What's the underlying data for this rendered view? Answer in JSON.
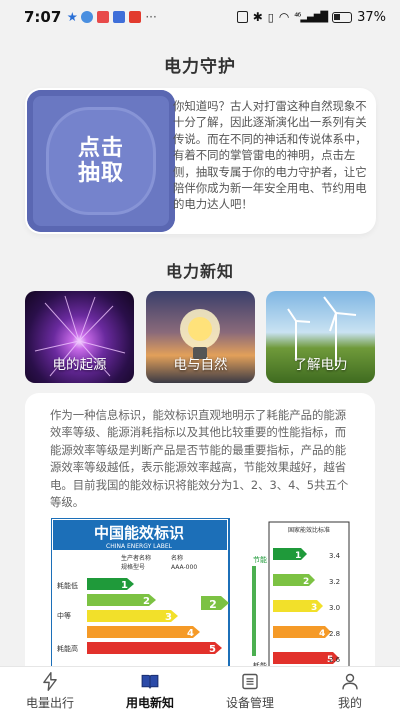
{
  "status_bar": {
    "time": "7:07",
    "signal_text": "⁴⁶",
    "battery": "37%",
    "more": "···"
  },
  "page": {
    "title": "电力守护"
  },
  "guard_card": {
    "button_label": "点击\n抽取",
    "text": "你知道吗？古人对打雷这种自然现象不十分了解，因此逐渐演化出一系列有关传说。而在不同的神话和传说体系中，有着不同的掌管雷电的神明，点击左侧，抽取专属于你的电力守护者，让它陪伴你成为新一年安全用电、节约用电的电力达人吧！"
  },
  "news_section": {
    "title": "电力新知",
    "items": [
      {
        "label": "电的起源"
      },
      {
        "label": "电与自然"
      },
      {
        "label": "了解电力"
      }
    ]
  },
  "info": {
    "text": "作为一种信息标识，能效标识直观地明示了耗能产品的能源效率等级、能源消耗指标以及其他比较重要的性能指标，而能源效率等级是判断产品是否节能的最重要指标，产品的能源效率等级越低，表示能源效率越高，节能效果越好，越省电。目前我国的能效标识将能效分为1、2、3、4、5共五个等级。",
    "label_title": "中国能效标识",
    "label_sub": "CHINA ENERGY LABEL",
    "label_left_top": "耗能低",
    "label_mid": "中等",
    "label_left_bottom": "耗能高",
    "label_arrow_value": "2",
    "producer": "生产者名称",
    "model": "规格型号",
    "producer_val": "名称",
    "model_val": "AAA-000",
    "levels": [
      "1",
      "2",
      "3",
      "4",
      "5"
    ],
    "level_colors": [
      "#1f9a3a",
      "#7cc243",
      "#f2e02a",
      "#f59a27",
      "#e2312b"
    ],
    "compare_title": "国家能效比标准",
    "compare_values": [
      "3.4",
      "3.2",
      "3.0",
      "2.8",
      "2.6"
    ],
    "save_label": "节能",
    "cost_label": "耗能"
  },
  "tabbar": {
    "items": [
      {
        "label": "电量出行"
      },
      {
        "label": "用电新知"
      },
      {
        "label": "设备管理"
      },
      {
        "label": "我的"
      }
    ]
  }
}
